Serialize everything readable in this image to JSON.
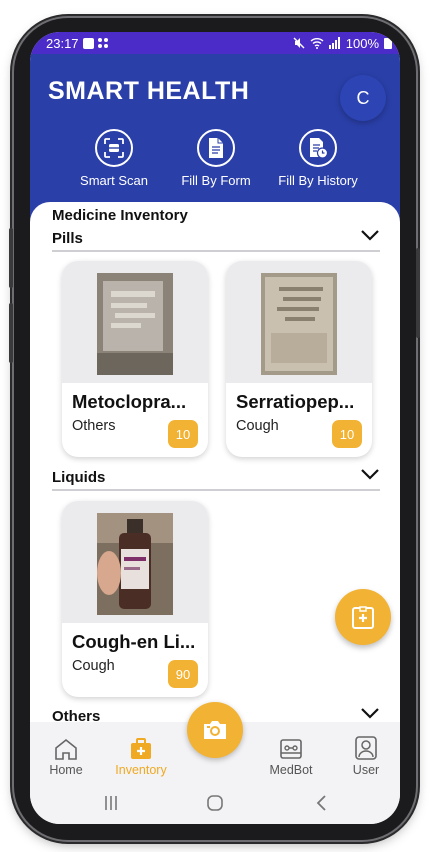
{
  "status_bar": {
    "time": "23:17",
    "battery": "100%"
  },
  "header": {
    "title": "SMART HEALTH",
    "avatar_letter": "C",
    "actions": [
      {
        "label": "Smart Scan",
        "icon": "scan-icon"
      },
      {
        "label": "Fill By Form",
        "icon": "document-icon"
      },
      {
        "label": "Fill By History",
        "icon": "history-document-icon"
      }
    ]
  },
  "inventory": {
    "title": "Medicine Inventory",
    "sections": [
      {
        "label": "Pills",
        "items": [
          {
            "name": "Metoclopra...",
            "category": "Others",
            "quantity": "10"
          },
          {
            "name": "Serratiopep...",
            "category": "Cough",
            "quantity": "10"
          }
        ]
      },
      {
        "label": "Liquids",
        "items": [
          {
            "name": "Cough-en Li...",
            "category": "Cough",
            "quantity": "90"
          }
        ]
      },
      {
        "label": "Others",
        "items": []
      }
    ]
  },
  "nav": [
    {
      "label": "Home",
      "icon": "home-icon",
      "active": false
    },
    {
      "label": "Inventory",
      "icon": "medical-kit-icon",
      "active": true
    },
    {
      "label": "MedBot",
      "icon": "robot-icon",
      "active": false
    },
    {
      "label": "User",
      "icon": "user-icon",
      "active": false
    }
  ],
  "colors": {
    "header": "#2a3fa8",
    "status_bar": "#4b2cc8",
    "accent": "#f2b233"
  }
}
